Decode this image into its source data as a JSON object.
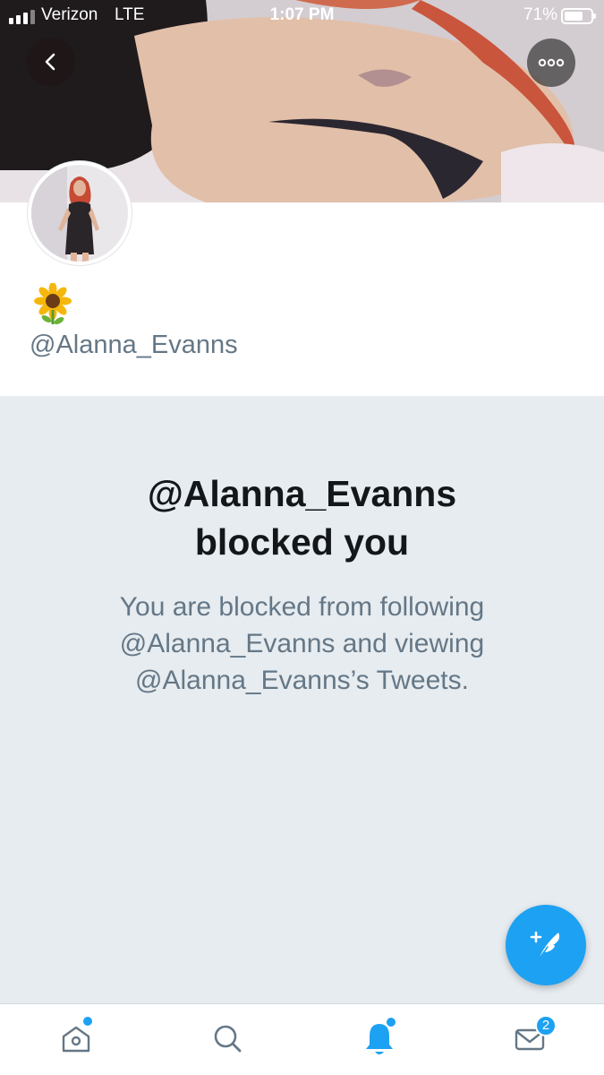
{
  "status_bar": {
    "carrier": "Verizon",
    "network": "LTE",
    "time": "1:07 PM",
    "battery_percent": "71%",
    "battery_level": 0.71,
    "signal_bars": 3
  },
  "header": {
    "back_icon": "chevron-left-icon",
    "more_icon": "more-horizontal-icon"
  },
  "profile": {
    "display_name_emoji": "🌻",
    "handle": "@Alanna_Evanns"
  },
  "blocked_notice": {
    "title_line1": "@Alanna_Evanns",
    "title_line2": "blocked you",
    "message_line1": "You are blocked from following",
    "message_line2": "@Alanna_Evanns and viewing",
    "message_line3": "@Alanna_Evanns’s Tweets."
  },
  "compose": {
    "icon": "compose-tweet-icon"
  },
  "tab_bar": {
    "home_icon": "home-icon",
    "search_icon": "search-icon",
    "notifications_icon": "bell-icon",
    "messages_icon": "mail-icon",
    "messages_badge": "2"
  },
  "colors": {
    "accent": "#1da1f2",
    "blocked_background": "#e6ecf0",
    "title_text": "#14171a",
    "secondary_text": "#657786"
  }
}
